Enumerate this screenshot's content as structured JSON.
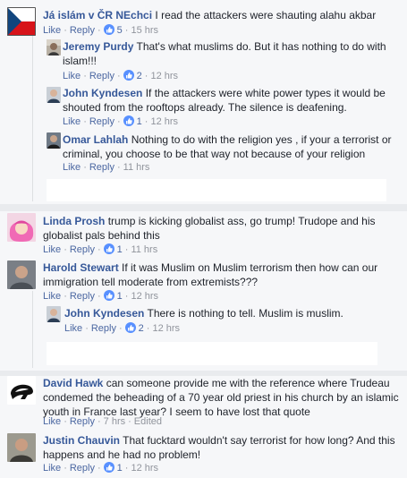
{
  "comments": [
    {
      "name": "Já islám v ČR NEchci",
      "text": "I read the attackers were shauting alahu akbar",
      "like": "Like",
      "reply": "Reply",
      "reactions": "5",
      "time": "15 hrs",
      "avatar": "czech-flag"
    },
    {
      "name": "Jeremy Purdy",
      "text": "That's what muslims do. But it has nothing to do with islam!!!",
      "like": "Like",
      "reply": "Reply",
      "reactions": "2",
      "time": "12 hrs",
      "avatar": "photo"
    },
    {
      "name": "John Kyndesen",
      "text": "If the attackers were white power types it would be shouted from the rooftops already. The silence is deafening.",
      "like": "Like",
      "reply": "Reply",
      "reactions": "1",
      "time": "12 hrs",
      "avatar": "photo"
    },
    {
      "name": "Omar Lahlah",
      "text": "Nothing to do with the religion yes , if your a terrorist or criminal, you choose to be that way not because of your religion",
      "like": "Like",
      "reply": "Reply",
      "time": "11 hrs",
      "avatar": "photo"
    },
    {
      "name": "Linda Prosh",
      "text": "trump is kicking globalist ass, go trump! Trudope and his globalist pals behind this",
      "like": "Like",
      "reply": "Reply",
      "reactions": "1",
      "time": "11 hrs",
      "avatar": "pink-hair"
    },
    {
      "name": "Harold Stewart",
      "text": "If it was Muslim on Muslim terrorism then how can our immigration tell moderate from extremists???",
      "like": "Like",
      "reply": "Reply",
      "reactions": "1",
      "time": "12 hrs",
      "avatar": "photo"
    },
    {
      "name": "John Kyndesen",
      "text": "There is nothing to tell. Muslim is muslim.",
      "like": "Like",
      "reply": "Reply",
      "reactions": "2",
      "time": "12 hrs",
      "avatar": "photo"
    },
    {
      "name": "David Hawk",
      "text": "can someone provide me with the reference where Trudeau condemed the beheading of a 70 year old priest in his church by an islamic youth in France last year? I seem to have lost that quote",
      "like": "Like",
      "reply": "Reply",
      "time": "7 hrs",
      "edited": "Edited",
      "avatar": "helmet"
    },
    {
      "name": "Justin Chauvin",
      "text": "That fucktard wouldn't say terrorist for how long? And this happens and he had no problem!",
      "like": "Like",
      "reply": "Reply",
      "reactions": "1",
      "time": "12 hrs",
      "avatar": "photo"
    }
  ]
}
